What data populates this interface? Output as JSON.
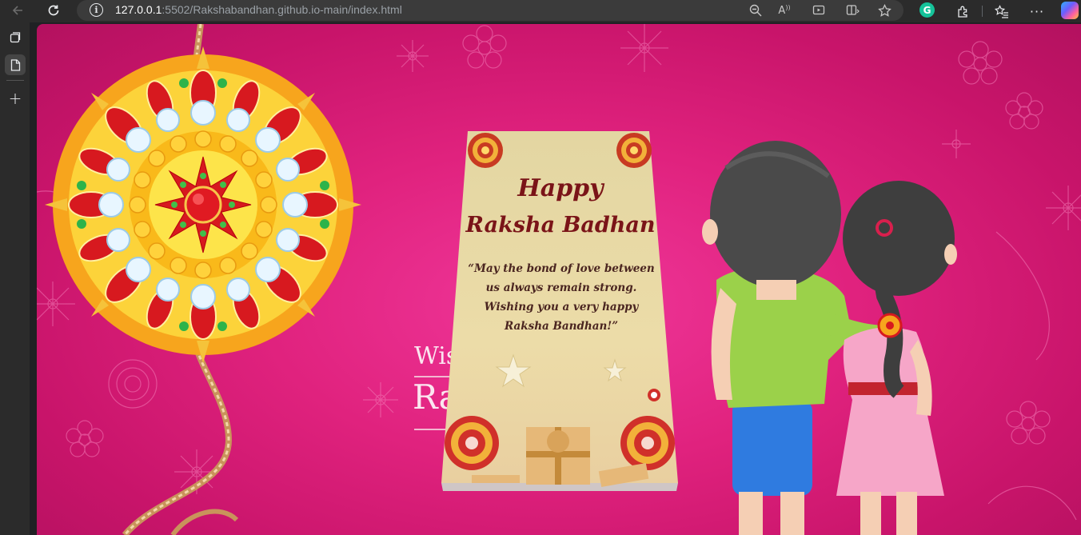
{
  "browser": {
    "url_host": "127.0.0.1",
    "url_rest": ":5502/Rakshabandhan.github.io-main/index.html",
    "icons": [
      "back-icon",
      "reload-icon",
      "info-icon",
      "zoom-out-icon",
      "read-aloud-icon",
      "immersive-reader-icon",
      "split-screen-icon",
      "favorite-star-icon",
      "grammarly-icon",
      "extensions-icon",
      "favorites-icon",
      "more-icon",
      "copilot-icon"
    ]
  },
  "sidebar": {
    "icons": [
      "tab-actions-icon",
      "page-icon",
      "new-tab-plus-icon"
    ]
  },
  "page": {
    "background_text_line1": "Wis",
    "background_text_line2": "Raks",
    "card": {
      "greeting_line1": "Happy",
      "greeting_line2": "Raksha Badhan",
      "quote": "“May the bond of love between us always remain strong. Wishing you a very happy Raksha Bandhan!”"
    }
  },
  "colors": {
    "page_background": "#e0227e",
    "card_background": "#e8dba0",
    "card_text": "#7a1418",
    "browser_chrome": "#2b2b2b"
  }
}
